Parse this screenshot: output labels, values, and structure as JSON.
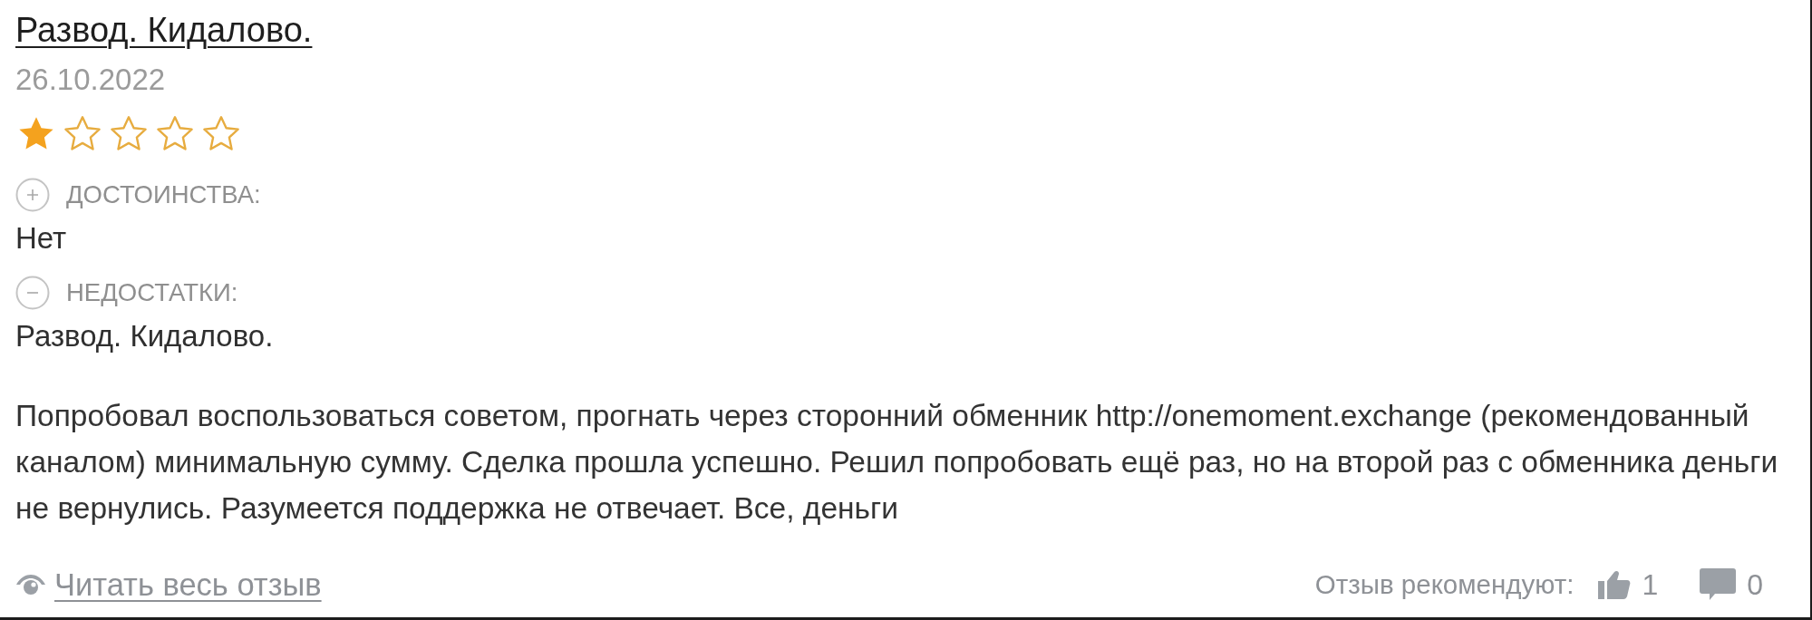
{
  "review": {
    "title": "Развод. Кидалово.",
    "date": "26.10.2022",
    "stars": 1,
    "sections": [
      {
        "kind": "pros",
        "label": "ДОСТОИНСТВА:",
        "text": "Нет"
      },
      {
        "kind": "cons",
        "label": "НЕДОСТАТКИ:",
        "text": "Развод. Кидалово."
      }
    ],
    "body": "Попробовал воспользоваться советом, прогнать через сторонний обменник http://onemoment.exchange (рекомендованный каналом) минимальную сумму. Сделка прошла успешно. Решил попробовать ещё раз, но на второй раз с обменника деньги не вернулись. Разумеется поддержка не отвечает. Все, деньги",
    "read_more": "Читать весь отзыв",
    "recommend_label": "Отзыв рекомендуют:",
    "likes": "1",
    "comments": "0"
  }
}
